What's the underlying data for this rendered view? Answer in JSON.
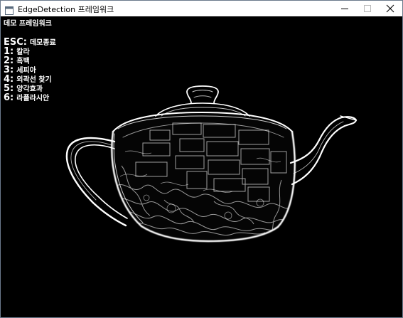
{
  "window": {
    "title": "EdgeDetection 프레임워크",
    "icon": "app-window-icon",
    "controls": [
      "minimize-icon",
      "maximize-icon",
      "close-icon"
    ]
  },
  "overlay": {
    "heading": "데모 프레임워크",
    "items": [
      {
        "key": "ESC:",
        "label": "데모종료"
      },
      {
        "key": "1:",
        "label": "칼라"
      },
      {
        "key": "2:",
        "label": "흑백"
      },
      {
        "key": "3:",
        "label": "세피아"
      },
      {
        "key": "4:",
        "label": "외곽선 찾기"
      },
      {
        "key": "5:",
        "label": "양각효과"
      },
      {
        "key": "6:",
        "label": "라플라시안"
      }
    ]
  },
  "scene": {
    "subject": "teapot",
    "background": "#000000",
    "edge_color": "#ffffff"
  }
}
